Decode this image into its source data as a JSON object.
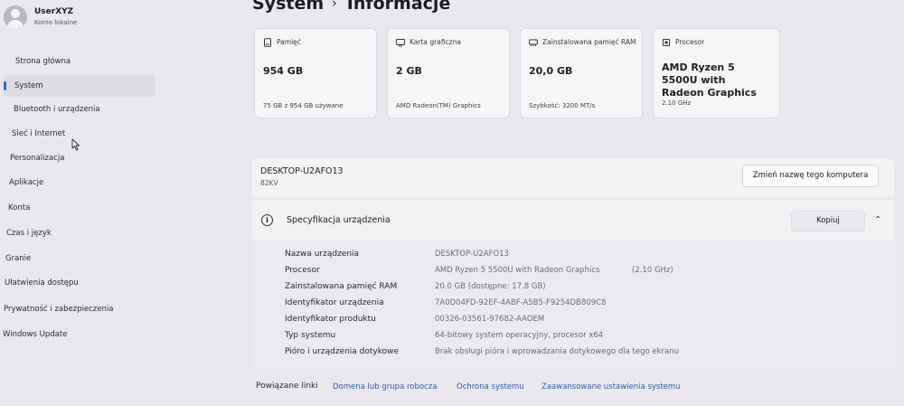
{
  "user": {
    "name": "UserXYZ",
    "account_type": "Konto lokalne"
  },
  "sidebar": {
    "items": [
      {
        "label": "Strona główna"
      },
      {
        "label": "System"
      },
      {
        "label": "Bluetooth i urządzenia"
      },
      {
        "label": "Sieć i Internet"
      },
      {
        "label": "Personalizacja"
      },
      {
        "label": "Aplikacje"
      },
      {
        "label": "Konta"
      },
      {
        "label": "Czas i język"
      },
      {
        "label": "Granie"
      },
      {
        "label": "Ułatwienia dostępu"
      },
      {
        "label": "Prywatność i zabezpieczenia"
      },
      {
        "label": "Windows Update"
      }
    ],
    "active_item": "System"
  },
  "header": {
    "crumb": "System",
    "separator": "›",
    "title": "Informacje"
  },
  "cards": [
    {
      "icon": "storage-icon",
      "label": "Pamięć",
      "value": "954 GB",
      "sub": "75 GB z 954 GB używane"
    },
    {
      "icon": "gpu-icon",
      "label": "Karta graficzna",
      "value": "2 GB",
      "sub": "AMD Radeon(TM) Graphics"
    },
    {
      "icon": "ram-icon",
      "label": "Zainstalowana pamięć RAM",
      "value": "20,0 GB",
      "sub": "Szybkość: 3200 MT/s"
    },
    {
      "icon": "processor-icon",
      "label": "Procesor",
      "value": "AMD Ryzen 5 5500U with Radeon Graphics",
      "sub": "2.10 GHz"
    }
  ],
  "device": {
    "name": "DESKTOP-U2AFO13",
    "model": "82KV",
    "rename_label": "Zmień nazwę tego komputera"
  },
  "spec": {
    "title": "Specyfikacja urządzenia",
    "copy_label": "Kopiuj",
    "rows": [
      {
        "label": "Nazwa urządzenia",
        "value": "DESKTOP-U2AFO13"
      },
      {
        "label": "Procesor",
        "value": "AMD Ryzen 5 5500U with Radeon Graphics",
        "extra": "(2.10 GHz)"
      },
      {
        "label": "Zainstalowana pamięć RAM",
        "value": "20.0 GB (dostępne: 17.8 GB)"
      },
      {
        "label": "Identyfikator urządzenia",
        "value": "7A0D04FD-92EF-4ABF-A5B5-F9254DB809C8"
      },
      {
        "label": "Identyfikator produktu",
        "value": "00326-03561-97682-AAOEM"
      },
      {
        "label": "Typ systemu",
        "value": "64-bitowy system operacyjny, procesor x64"
      },
      {
        "label": "Pióro i urządzenia dotykowe",
        "value": "Brak obsługi pióra i wprowadzania dotykowego dla tego ekranu"
      }
    ]
  },
  "related": {
    "label": "Powiązane linki",
    "links": [
      {
        "label": "Domena lub grupa robocza"
      },
      {
        "label": "Ochrona systemu"
      },
      {
        "label": "Zaawansowane ustawienia systemu"
      }
    ]
  },
  "colors": {
    "accent": "#2f6ad1",
    "link": "#2b5fb8",
    "background": "#eae8ec",
    "card": "#f6f5f8"
  }
}
